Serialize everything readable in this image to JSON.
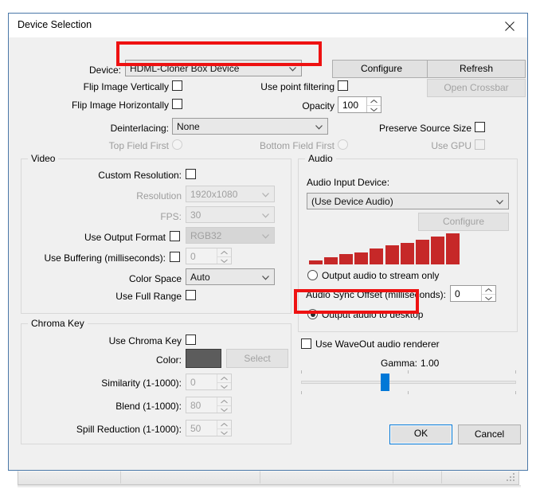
{
  "window": {
    "title": "Device Selection",
    "close_icon": "close-icon"
  },
  "top": {
    "device_label": "Device:",
    "device_value": "HDML-Cloner Box Device",
    "configure_label": "Configure",
    "refresh_label": "Refresh",
    "open_crossbar_label": "Open Crossbar",
    "flip_vertically_label": "Flip Image Vertically",
    "flip_horizontally_label": "Flip Image Horizontally",
    "use_point_filtering_label": "Use point filtering",
    "opacity_label": "Opacity",
    "opacity_value": "100",
    "deinterlacing_label": "Deinterlacing:",
    "deinterlacing_value": "None",
    "preserve_source_size_label": "Preserve Source Size",
    "top_field_first_label": "Top Field First",
    "bottom_field_first_label": "Bottom Field First",
    "use_gpu_label": "Use GPU"
  },
  "video": {
    "group_title": "Video",
    "custom_resolution_label": "Custom Resolution:",
    "resolution_label": "Resolution",
    "resolution_value": "1920x1080",
    "fps_label": "FPS:",
    "fps_value": "30",
    "use_output_format_label": "Use Output Format",
    "output_format_value": "RGB32",
    "use_buffering_label": "Use Buffering (milliseconds):",
    "buffering_value": "0",
    "color_space_label": "Color Space",
    "color_space_value": "Auto",
    "use_full_range_label": "Use Full Range"
  },
  "chroma": {
    "group_title": "Chroma Key",
    "use_chroma_key_label": "Use Chroma Key",
    "color_label": "Color:",
    "color_value": "#5c5c5c",
    "select_label": "Select",
    "similarity_label": "Similarity (1-1000):",
    "similarity_value": "0",
    "blend_label": "Blend (1-1000):",
    "blend_value": "80",
    "spill_reduction_label": "Spill Reduction (1-1000):",
    "spill_reduction_value": "50"
  },
  "audio": {
    "group_title": "Audio",
    "input_device_label": "Audio Input Device:",
    "input_device_value": "(Use Device Audio)",
    "configure_label": "Configure",
    "meter_levels": [
      5,
      9,
      13,
      15,
      20,
      24,
      27,
      31,
      35,
      39
    ],
    "meter_color": "#c62828",
    "output_stream_only_label": "Output audio to stream only",
    "sync_offset_label": "Audio Sync Offset (milliseconds):",
    "sync_offset_value": "0",
    "output_desktop_label": "Output audio to desktop",
    "use_waveout_label": "Use WaveOut audio renderer",
    "gamma_label": "Gamma:",
    "gamma_value": "1.00"
  },
  "footer": {
    "ok_label": "OK",
    "cancel_label": "Cancel"
  },
  "annotations": {
    "highlight_color": "#ee1111",
    "boxes": [
      "device-row-highlight",
      "output-audio-to-desktop-highlight"
    ]
  }
}
